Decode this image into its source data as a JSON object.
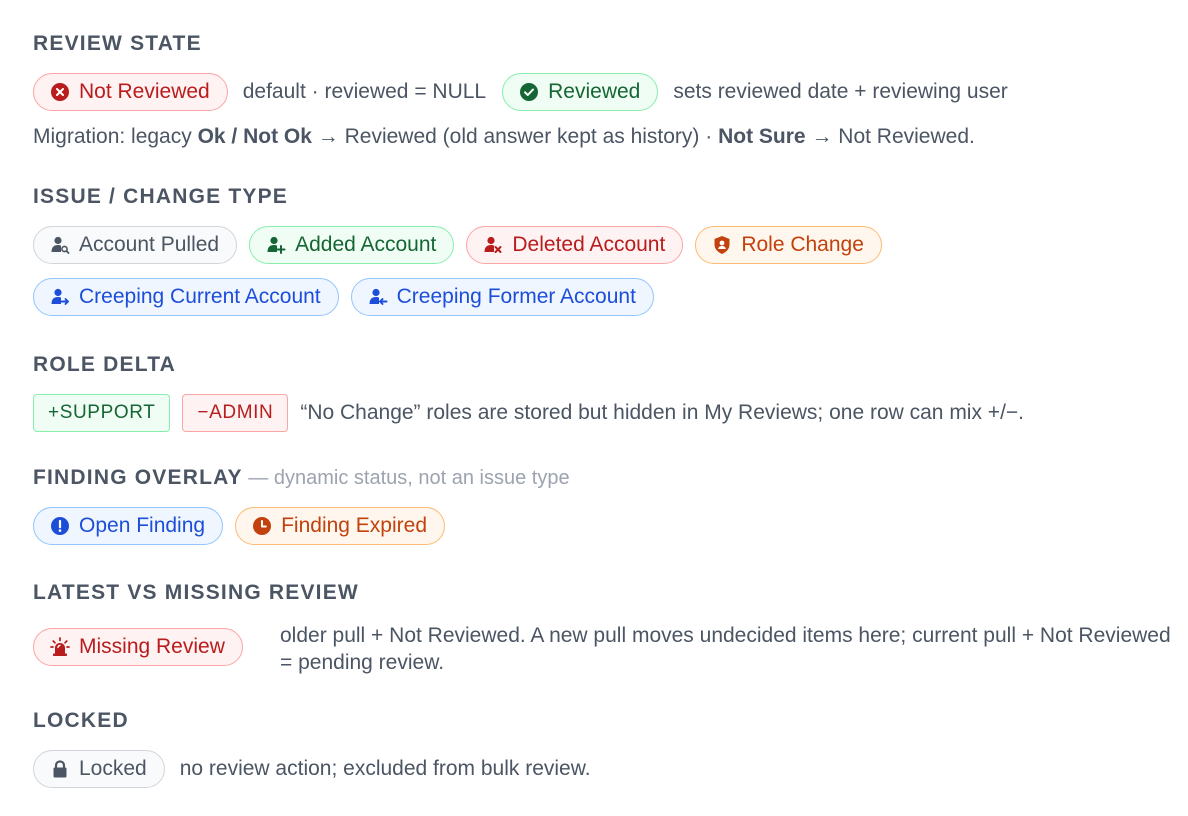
{
  "review_state": {
    "heading": "REVIEW STATE",
    "not_reviewed_label": "Not Reviewed",
    "not_reviewed_note": "default · reviewed = NULL",
    "reviewed_label": "Reviewed",
    "reviewed_note": "sets reviewed date + reviewing user",
    "migration": {
      "prefix": "Migration: legacy ",
      "legacy_values": "Ok / Not Ok",
      "arrow_one": " → Reviewed (old answer kept as history) · ",
      "not_sure": "Not Sure",
      "arrow_two": " → Not Reviewed."
    }
  },
  "issue_type": {
    "heading": "ISSUE / CHANGE TYPE",
    "pills": [
      {
        "label": "Account Pulled",
        "color": "gray",
        "icon": "user-search-icon"
      },
      {
        "label": "Added Account",
        "color": "green",
        "icon": "user-plus-icon"
      },
      {
        "label": "Deleted Account",
        "color": "red",
        "icon": "user-x-icon"
      },
      {
        "label": "Role Change",
        "color": "orange",
        "icon": "shield-user-icon"
      },
      {
        "label": "Creeping Current Account",
        "color": "blue",
        "icon": "user-arrow-right-icon"
      },
      {
        "label": "Creeping Former Account",
        "color": "blue",
        "icon": "user-arrow-left-icon"
      }
    ]
  },
  "role_delta": {
    "heading": "ROLE DELTA",
    "plus_tag": "+SUPPORT",
    "minus_tag": "−ADMIN",
    "note": "“No Change” roles are stored but hidden in My Reviews; one row can mix +/−."
  },
  "finding_overlay": {
    "heading": "FINDING OVERLAY",
    "subheading": " — dynamic status, not an issue type",
    "open_label": "Open Finding",
    "expired_label": "Finding Expired"
  },
  "latest_vs_missing": {
    "heading": "LATEST VS MISSING REVIEW",
    "missing_label": "Missing Review",
    "note": "older pull + Not Reviewed. A new pull moves undecided items here; current pull + Not Reviewed = pending review."
  },
  "locked": {
    "heading": "LOCKED",
    "label": "Locked",
    "note": "no review action; excluded from bulk review."
  },
  "colors": {
    "red": "#b91c1c",
    "green": "#166534",
    "gray": "#4b5563",
    "orange": "#c2410c",
    "blue": "#1d4ed8"
  }
}
